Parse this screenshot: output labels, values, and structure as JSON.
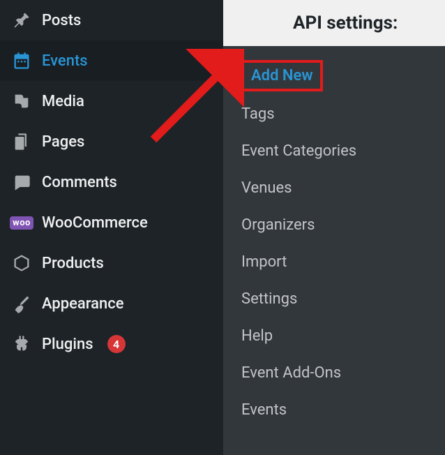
{
  "header": {
    "title": "API settings:"
  },
  "menu": {
    "items": [
      {
        "label": "Posts",
        "icon": "pin-icon"
      },
      {
        "label": "Events",
        "icon": "calendar-icon",
        "active": true
      },
      {
        "label": "Media",
        "icon": "media-icon"
      },
      {
        "label": "Pages",
        "icon": "pages-icon"
      },
      {
        "label": "Comments",
        "icon": "comment-icon"
      },
      {
        "label": "WooCommerce",
        "icon": "woo-icon"
      },
      {
        "label": "Products",
        "icon": "products-icon"
      },
      {
        "label": "Appearance",
        "icon": "appearance-icon"
      },
      {
        "label": "Plugins",
        "icon": "plugins-icon",
        "badge": "4"
      }
    ]
  },
  "submenu": {
    "items": [
      {
        "label": "Add New",
        "highlighted": true
      },
      {
        "label": "Tags"
      },
      {
        "label": "Event Categories"
      },
      {
        "label": "Venues"
      },
      {
        "label": "Organizers"
      },
      {
        "label": "Import"
      },
      {
        "label": "Settings"
      },
      {
        "label": "Help"
      },
      {
        "label": "Event Add-Ons"
      },
      {
        "label": "Events"
      }
    ]
  },
  "woo_text": "woo",
  "colors": {
    "accent": "#2995d4",
    "highlight_border": "#e21b1b",
    "badge": "#d63638"
  }
}
